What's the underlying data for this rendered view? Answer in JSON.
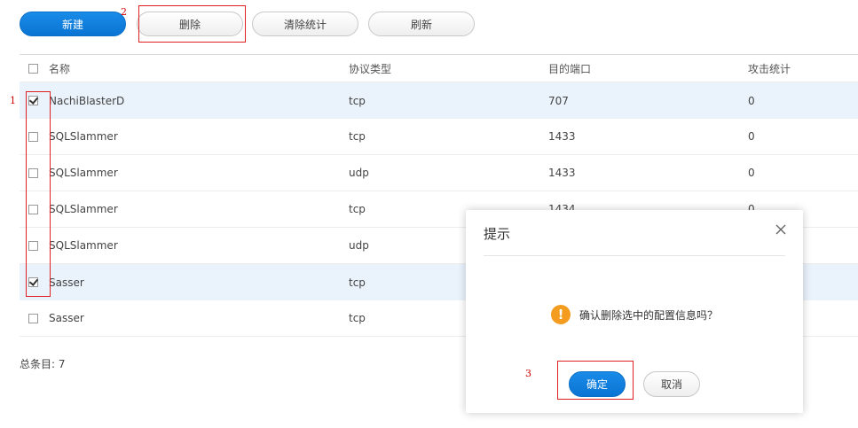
{
  "toolbar": {
    "new_label": "新建",
    "delete_label": "删除",
    "clear_stats_label": "清除统计",
    "refresh_label": "刷新"
  },
  "table": {
    "columns": [
      "名称",
      "协议类型",
      "目的端口",
      "攻击统计"
    ],
    "rows": [
      {
        "name": "NachiBlasterD",
        "protocol": "tcp",
        "port": "707",
        "attacks": "0",
        "checked": true
      },
      {
        "name": "SQLSlammer",
        "protocol": "tcp",
        "port": "1433",
        "attacks": "0",
        "checked": false
      },
      {
        "name": "SQLSlammer",
        "protocol": "udp",
        "port": "1433",
        "attacks": "0",
        "checked": false
      },
      {
        "name": "SQLSlammer",
        "protocol": "tcp",
        "port": "1434",
        "attacks": "0",
        "checked": false
      },
      {
        "name": "SQLSlammer",
        "protocol": "udp",
        "port": "",
        "attacks": "",
        "checked": false
      },
      {
        "name": "Sasser",
        "protocol": "tcp",
        "port": "",
        "attacks": "",
        "checked": true
      },
      {
        "name": "Sasser",
        "protocol": "tcp",
        "port": "",
        "attacks": "",
        "checked": false
      }
    ]
  },
  "footer": {
    "total_label": "总条目: 7"
  },
  "dialog": {
    "title": "提示",
    "message": "确认删除选中的配置信息吗？",
    "ok_label": "确定",
    "cancel_label": "取消",
    "icon": "warning-icon",
    "close_icon": "close-icon"
  },
  "annotations": [
    "1",
    "2",
    "3"
  ],
  "colors": {
    "primary": "#0a74d3",
    "selected_row": "#eaf2fb",
    "annotation": "#e02020",
    "warning": "#f39c1f"
  }
}
